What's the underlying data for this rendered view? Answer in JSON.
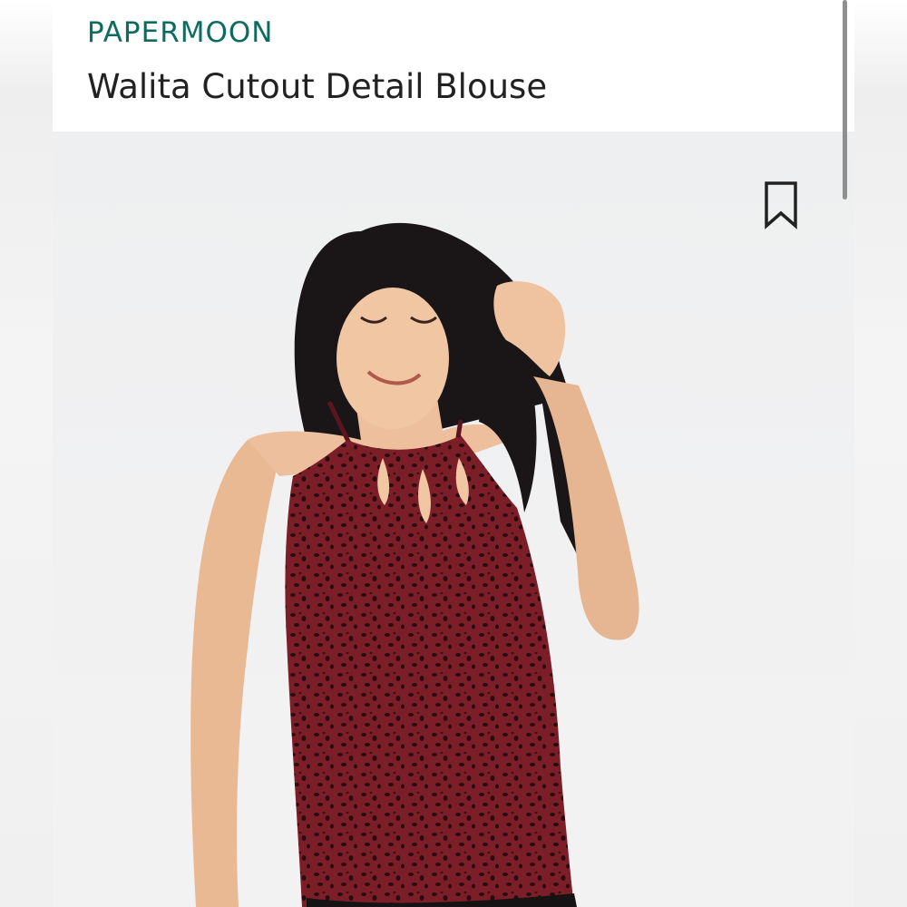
{
  "product": {
    "brand": "PAPERMOON",
    "title": "Walita Cutout Detail Blouse"
  },
  "icons": {
    "bookmark": "bookmark-icon"
  },
  "colors": {
    "brand": "#0d6b60",
    "title": "#222222",
    "blouse": "#7a1e26"
  }
}
